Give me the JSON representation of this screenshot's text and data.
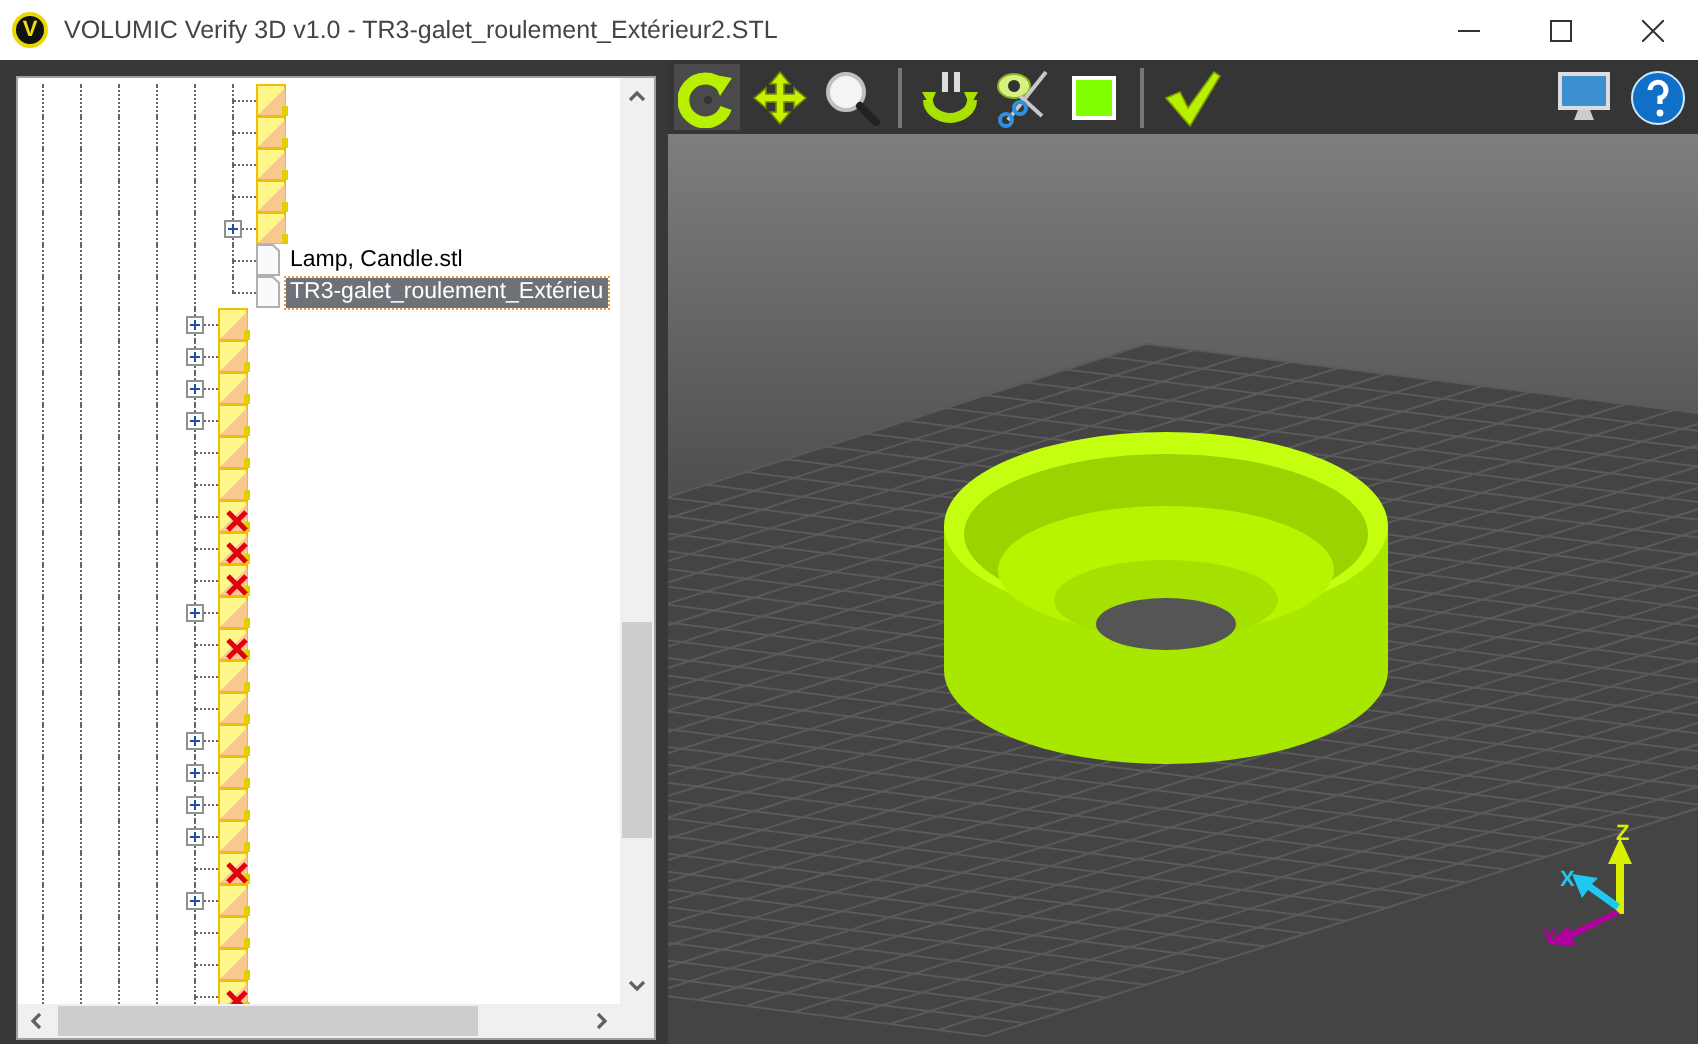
{
  "window": {
    "logo_letter": "V",
    "title": "VOLUMIC Verify 3D v1.0 - TR3-galet_roulement_Extérieur2.STL"
  },
  "tree": {
    "items": [
      {
        "kind": "continued",
        "children": [
          {
            "kind": "folder",
            "expandable": false,
            "error": false
          },
          {
            "kind": "folder",
            "expandable": false,
            "error": false
          },
          {
            "kind": "folder",
            "expandable": false,
            "error": false
          },
          {
            "kind": "folder",
            "expandable": false,
            "error": false
          },
          {
            "kind": "folder",
            "expandable": true,
            "error": false
          },
          {
            "kind": "file",
            "label": "Lamp, Candle.stl",
            "selected": false
          },
          {
            "kind": "file",
            "label": "TR3-galet_roulement_Extérieu",
            "selected": true
          }
        ]
      },
      {
        "kind": "folder",
        "expandable": true,
        "error": false
      },
      {
        "kind": "folder",
        "expandable": true,
        "error": false
      },
      {
        "kind": "folder",
        "expandable": true,
        "error": false
      },
      {
        "kind": "folder",
        "expandable": true,
        "error": false
      },
      {
        "kind": "folder",
        "expandable": false,
        "error": false
      },
      {
        "kind": "folder",
        "expandable": false,
        "error": false
      },
      {
        "kind": "folder",
        "expandable": false,
        "error": true
      },
      {
        "kind": "folder",
        "expandable": false,
        "error": true
      },
      {
        "kind": "folder",
        "expandable": false,
        "error": true
      },
      {
        "kind": "folder",
        "expandable": true,
        "error": false
      },
      {
        "kind": "folder",
        "expandable": false,
        "error": true
      },
      {
        "kind": "folder",
        "expandable": false,
        "error": false
      },
      {
        "kind": "folder",
        "expandable": false,
        "error": false
      },
      {
        "kind": "folder",
        "expandable": true,
        "error": false
      },
      {
        "kind": "folder",
        "expandable": true,
        "error": false
      },
      {
        "kind": "folder",
        "expandable": true,
        "error": false
      },
      {
        "kind": "folder",
        "expandable": true,
        "error": false
      },
      {
        "kind": "folder",
        "expandable": false,
        "error": true
      },
      {
        "kind": "folder",
        "expandable": true,
        "error": false
      },
      {
        "kind": "folder",
        "expandable": false,
        "error": false
      },
      {
        "kind": "folder",
        "expandable": false,
        "error": false
      },
      {
        "kind": "folder",
        "expandable": false,
        "error": true
      }
    ]
  },
  "toolbar": {
    "groups": [
      [
        {
          "kind": "rotate",
          "selected": true
        },
        {
          "kind": "pan",
          "selected": false
        },
        {
          "kind": "zoom",
          "selected": false
        }
      ],
      [
        {
          "kind": "auto-rotate",
          "selected": false
        },
        {
          "kind": "clip",
          "selected": false
        },
        {
          "kind": "color",
          "color": "#80ff00",
          "selected": false
        }
      ],
      [
        {
          "kind": "validate",
          "selected": false
        }
      ]
    ],
    "right": [
      {
        "kind": "display"
      },
      {
        "kind": "help"
      }
    ]
  },
  "axes": {
    "labels": [
      {
        "text": "Z"
      },
      {
        "text": "X"
      },
      {
        "text": "Y"
      }
    ]
  }
}
